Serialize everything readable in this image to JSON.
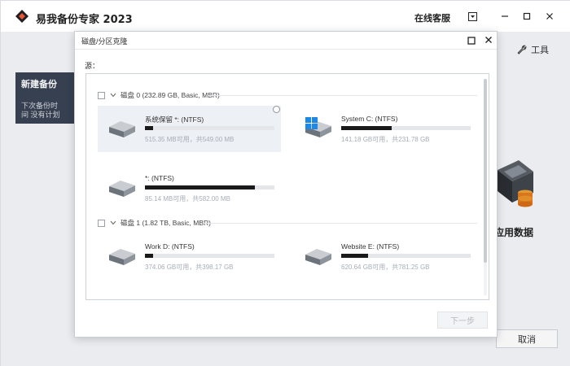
{
  "app": {
    "title": "易我备份专家 2023",
    "online_service": "在线客服",
    "tools_label": "工具"
  },
  "side_panel": {
    "title": "新建备份",
    "description": "下次备份时间 没有计划"
  },
  "background": {
    "app_data_label": "应用数据",
    "cancel_label": "取消"
  },
  "dialog": {
    "title": "磁盘/分区克隆",
    "source_label": "源：",
    "next_label": "下一步",
    "disks": [
      {
        "label": "磁盘 0 (232.89 GB, Basic, MBR)",
        "partitions": [
          {
            "name": "系统保留 *: (NTFS)",
            "capacity": "515.35 MB可用，共549.00 MB",
            "usage": 0.06,
            "icon": "drive-icon",
            "selected": true
          },
          {
            "name": "System C: (NTFS)",
            "capacity": "141.18 GB可用，共231.78 GB",
            "usage": 0.39,
            "icon": "windows-drive-icon",
            "selected": false
          },
          {
            "name": "*: (NTFS)",
            "capacity": "85.14 MB可用，共582.00 MB",
            "usage": 0.85,
            "icon": "drive-icon",
            "selected": false
          }
        ]
      },
      {
        "label": "磁盘 1 (1.82 TB, Basic, MBR)",
        "partitions": [
          {
            "name": "Work D: (NTFS)",
            "capacity": "374.06 GB可用，共398.17 GB",
            "usage": 0.06,
            "icon": "drive-icon",
            "selected": false
          },
          {
            "name": "Website E: (NTFS)",
            "capacity": "620.64 GB可用，共781.25 GB",
            "usage": 0.21,
            "icon": "drive-icon",
            "selected": false
          }
        ]
      }
    ]
  },
  "colors": {
    "side_panel_bg": "#3a4354",
    "usage_bar": "#1a1a1a",
    "windows_blue": "#1e88e5",
    "selected_card_bg": "#edf0f4"
  }
}
